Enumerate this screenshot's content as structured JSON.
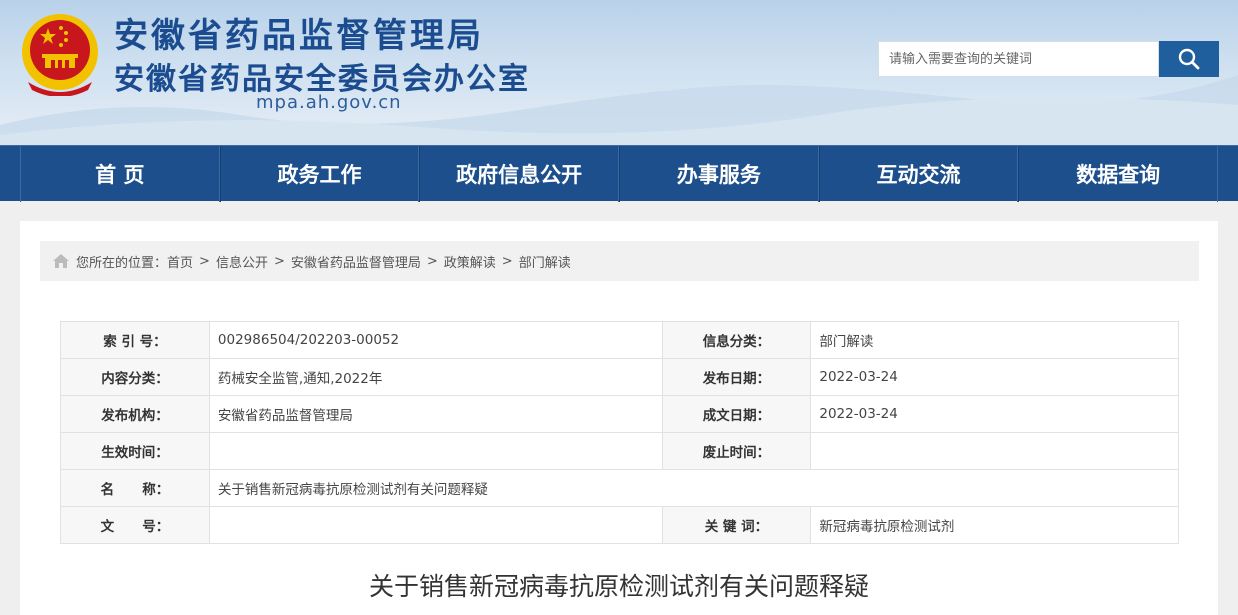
{
  "header": {
    "title1": "安徽省药品监督管理局",
    "title2": "安徽省药品安全委员会办公室",
    "domain": "mpa.ah.gov.cn",
    "search_placeholder": "请输入需要查询的关键词",
    "search_icon": "search-icon"
  },
  "nav": {
    "items": [
      "首 页",
      "政务工作",
      "政府信息公开",
      "办事服务",
      "互动交流",
      "数据查询"
    ]
  },
  "breadcrumb": {
    "prefix": "您所在的位置：",
    "items": [
      "首页",
      "信息公开",
      "安徽省药品监督管理局",
      "政策解读",
      "部门解读"
    ],
    "separator": ">"
  },
  "meta": {
    "index_label": "索 引 号：",
    "index_value": "002986504/202203-00052",
    "info_class_label": "信息分类：",
    "info_class_value": "部门解读",
    "content_class_label": "内容分类：",
    "content_class_value": "药械安全监管,通知,2022年",
    "publish_date_label": "发布日期：",
    "publish_date_value": "2022-03-24",
    "publisher_label": "发布机构：",
    "publisher_value": "安徽省药品监督管理局",
    "written_date_label": "成文日期：",
    "written_date_value": "2022-03-24",
    "effective_label": "生效时间：",
    "effective_value": "",
    "expire_label": "废止时间：",
    "expire_value": "",
    "name_label": "名      称：",
    "name_value": "关于销售新冠病毒抗原检测试剂有关问题释疑",
    "doc_no_label": "文      号：",
    "doc_no_value": "",
    "keywords_label": "关 键 词：",
    "keywords_value": "新冠病毒抗原检测试剂"
  },
  "article": {
    "title": "关于销售新冠病毒抗原检测试剂有关问题释疑"
  },
  "colors": {
    "brand_blue": "#1d4f8c",
    "title_blue": "#1a4c8f",
    "emblem_red": "#c8161d",
    "emblem_gold": "#f2c200"
  }
}
